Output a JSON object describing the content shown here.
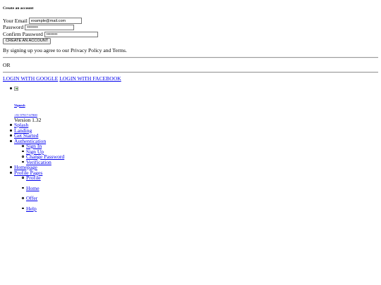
{
  "signup": {
    "title": "Create an account",
    "email_label": "Your Email",
    "email_value": "example@mail.com",
    "password_label": "Password",
    "password_value": "••••••••",
    "confirm_label": "Confirm Password",
    "confirm_value": "••••••••",
    "create_button": "CREATE AN ACCOUNT",
    "agree_text": "By signing up you agree to our Privacy Policy and Terms."
  },
  "divider": {
    "or_text": "OR"
  },
  "social": {
    "google": "LOGIN WITH GOOGLE",
    "facebook": "LOGIN WITH FACEBOOK"
  },
  "profile": {
    "avatar_icon": "user-avatar-image",
    "name": "Vignesh",
    "phone": "+91 97917-67800",
    "version": "Version 1.32"
  },
  "menu": {
    "splash": "Splash",
    "landing": "Landing",
    "get_started": "Get Started",
    "authentication": "Authentication",
    "auth_items": [
      "Sign In",
      "Sign Up",
      "Change Password",
      "Verification"
    ],
    "homepage": "Homepage",
    "profile_pages": "Profile Pages",
    "profile_items": [
      "Profile",
      "Home",
      "Offer",
      "Help"
    ]
  }
}
